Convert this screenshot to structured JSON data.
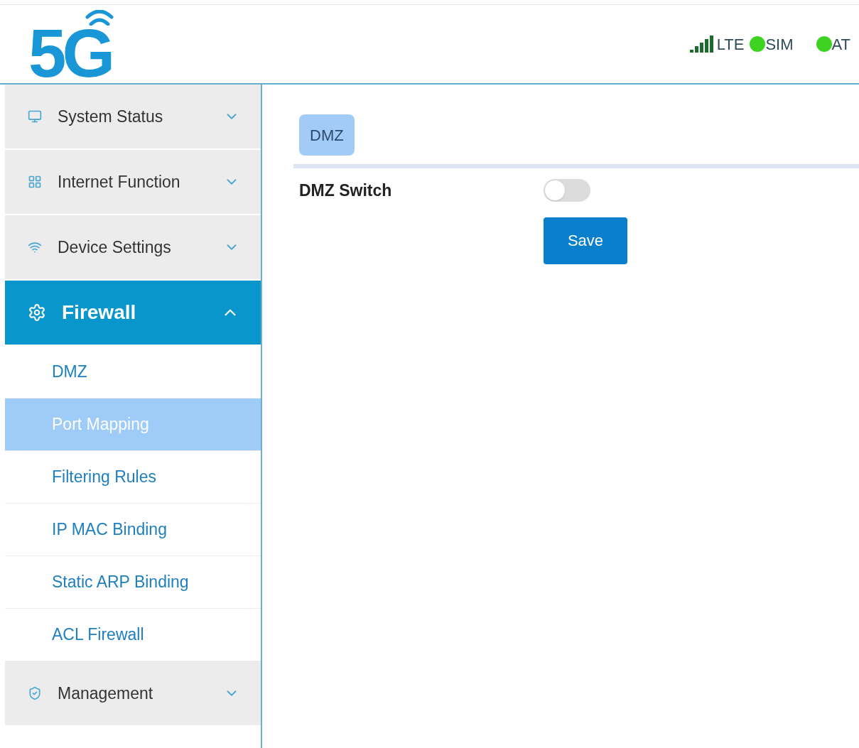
{
  "header": {
    "logo": "5G",
    "status": [
      {
        "label": "LTE",
        "kind": "signal"
      },
      {
        "label": "SIM",
        "kind": "dot",
        "color": "#3ed321"
      },
      {
        "label": "AT",
        "kind": "dot",
        "color": "#3ed321"
      }
    ]
  },
  "sidebar": {
    "items": [
      {
        "label": "System Status",
        "expanded": false
      },
      {
        "label": "Internet Function",
        "expanded": false
      },
      {
        "label": "Device Settings",
        "expanded": false
      },
      {
        "label": "Firewall",
        "expanded": true,
        "children": [
          {
            "label": "DMZ",
            "selected": false
          },
          {
            "label": "Port Mapping",
            "selected": true
          },
          {
            "label": "Filtering Rules",
            "selected": false
          },
          {
            "label": "IP MAC Binding",
            "selected": false
          },
          {
            "label": "Static ARP Binding",
            "selected": false
          },
          {
            "label": "ACL Firewall",
            "selected": false
          }
        ]
      },
      {
        "label": "Management",
        "expanded": false
      }
    ]
  },
  "tabs": [
    {
      "label": "DMZ",
      "selected": true
    }
  ],
  "form": {
    "switch_label": "DMZ Switch",
    "switch_on": false,
    "button": "Save"
  }
}
